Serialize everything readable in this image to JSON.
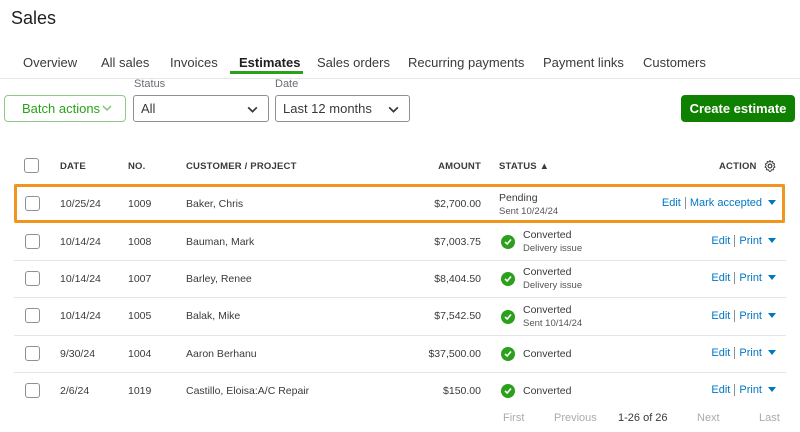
{
  "page": {
    "title": "Sales"
  },
  "tabs": [
    {
      "label": "Overview"
    },
    {
      "label": "All sales"
    },
    {
      "label": "Invoices"
    },
    {
      "label": "Estimates"
    },
    {
      "label": "Sales orders"
    },
    {
      "label": "Recurring payments"
    },
    {
      "label": "Payment links"
    },
    {
      "label": "Customers"
    }
  ],
  "active_tab": "Estimates",
  "toolbar": {
    "batch_label": "Batch actions",
    "status_label": "Status",
    "status_value": "All",
    "date_label": "Date",
    "date_value": "Last 12 months",
    "create_label": "Create estimate"
  },
  "table": {
    "headers": {
      "date": "DATE",
      "no": "NO.",
      "customer": "CUSTOMER / PROJECT",
      "amount": "AMOUNT",
      "status": "STATUS ▲",
      "action": "ACTION"
    },
    "rows": [
      {
        "date": "10/25/24",
        "no": "1009",
        "customer": "Baker, Chris",
        "amount": "$2,700.00",
        "status": "Pending",
        "status_sub": "Sent 10/24/24",
        "action_primary": "Edit",
        "action_secondary": "Mark accepted"
      },
      {
        "date": "10/14/24",
        "no": "1008",
        "customer": "Bauman, Mark",
        "amount": "$7,003.75",
        "status": "Converted",
        "status_sub": "Delivery issue",
        "action_primary": "Edit",
        "action_secondary": "Print"
      },
      {
        "date": "10/14/24",
        "no": "1007",
        "customer": "Barley, Renee",
        "amount": "$8,404.50",
        "status": "Converted",
        "status_sub": "Delivery issue",
        "action_primary": "Edit",
        "action_secondary": "Print"
      },
      {
        "date": "10/14/24",
        "no": "1005",
        "customer": "Balak, Mike",
        "amount": "$7,542.50",
        "status": "Converted",
        "status_sub": "Sent 10/14/24",
        "action_primary": "Edit",
        "action_secondary": "Print"
      },
      {
        "date": "9/30/24",
        "no": "1004",
        "customer": "Aaron Berhanu",
        "amount": "$37,500.00",
        "status": "Converted",
        "status_sub": "",
        "action_primary": "Edit",
        "action_secondary": "Print"
      },
      {
        "date": "2/6/24",
        "no": "1019",
        "customer": "Castillo, Eloisa:A/C Repair",
        "amount": "$150.00",
        "status": "Converted",
        "status_sub": "",
        "action_primary": "Edit",
        "action_secondary": "Print"
      }
    ]
  },
  "pager": {
    "first": "First",
    "previous": "Previous",
    "count": "1-26 of 26",
    "next": "Next",
    "last": "Last"
  },
  "colors": {
    "accent_green": "#2ca01c",
    "button_green": "#108000",
    "link_blue": "#0077c5",
    "highlight_orange": "#f0961e"
  },
  "icons": {
    "status_converted": "check-circle-icon",
    "settings": "gear-icon",
    "dropdown": "chevron-down-icon"
  }
}
